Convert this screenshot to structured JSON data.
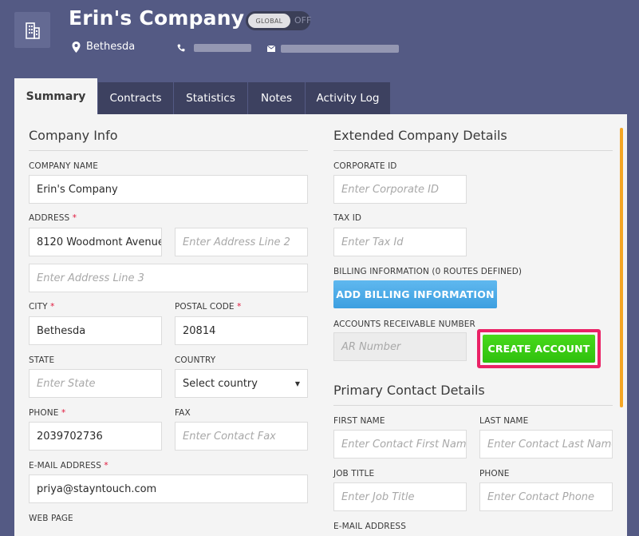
{
  "header": {
    "company_name": "Erin's Company",
    "toggle_label": "GLOBAL",
    "toggle_state": "OFF",
    "location": "Bethesda",
    "icons": [
      "building-icon",
      "location-pin-icon",
      "phone-icon",
      "email-icon"
    ]
  },
  "tabs": [
    {
      "label": "Summary",
      "active": true
    },
    {
      "label": "Contracts",
      "active": false
    },
    {
      "label": "Statistics",
      "active": false
    },
    {
      "label": "Notes",
      "active": false
    },
    {
      "label": "Activity Log",
      "active": false
    }
  ],
  "company_info": {
    "title": "Company Info",
    "company_name_label": "COMPANY NAME",
    "company_name_value": "Erin's Company",
    "address_label": "ADDRESS",
    "address_line1_value": "8120 Woodmont Avenue",
    "address_line2_placeholder": "Enter Address Line 2",
    "address_line3_placeholder": "Enter Address Line 3",
    "city_label": "CITY",
    "city_value": "Bethesda",
    "postal_code_label": "POSTAL CODE",
    "postal_code_value": "20814",
    "state_label": "STATE",
    "state_placeholder": "Enter State",
    "country_label": "COUNTRY",
    "country_value": "Select country",
    "phone_label": "PHONE",
    "phone_value": "2039702736",
    "fax_label": "FAX",
    "fax_placeholder": "Enter Contact Fax",
    "email_label": "E-MAIL ADDRESS",
    "email_value": "priya@stayntouch.com",
    "web_page_label": "WEB PAGE",
    "required_marker": "*"
  },
  "extended": {
    "title": "Extended Company Details",
    "corporate_id_label": "CORPORATE ID",
    "corporate_id_placeholder": "Enter Corporate ID",
    "tax_id_label": "TAX ID",
    "tax_id_placeholder": "Enter Tax Id",
    "billing_label": "BILLING INFORMATION (0 ROUTES DEFINED)",
    "billing_button": "ADD BILLING INFORMATION",
    "ar_label": "ACCOUNTS RECEIVABLE NUMBER",
    "ar_placeholder": "AR Number",
    "create_account_button": "CREATE ACCOUNT"
  },
  "primary_contact": {
    "title": "Primary Contact Details",
    "first_name_label": "FIRST NAME",
    "first_name_placeholder": "Enter Contact First Name",
    "last_name_label": "LAST NAME",
    "last_name_placeholder": "Enter Contact Last Name",
    "job_title_label": "JOB TITLE",
    "job_title_placeholder": "Enter Job Title",
    "phone_label": "PHONE",
    "phone_placeholder": "Enter Contact Phone",
    "email_label": "E-MAIL ADDRESS"
  },
  "colors": {
    "background": "#545a84",
    "tab_inactive": "#3d4160",
    "panel": "#f4f4f4",
    "billing_button": "#4aa9e8",
    "create_button": "#3bcc14",
    "highlight": "#ea2266",
    "scrollbar": "#f5a623"
  }
}
